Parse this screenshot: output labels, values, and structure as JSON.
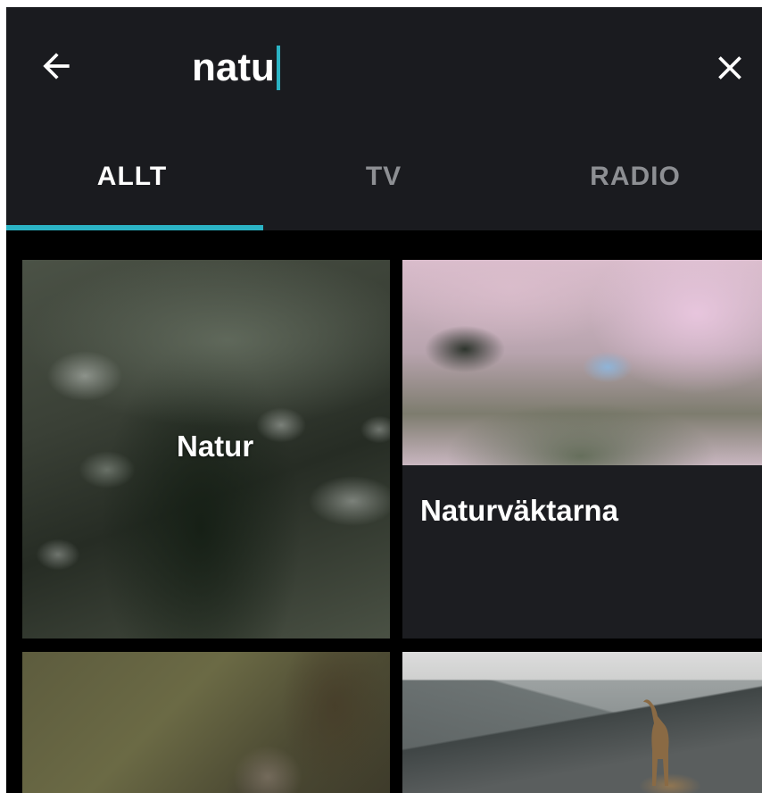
{
  "search": {
    "query": "natu",
    "back_icon": "arrow-left-icon",
    "clear_icon": "close-icon"
  },
  "tabs": [
    {
      "label": "ALLT",
      "active": true
    },
    {
      "label": "TV",
      "active": false
    },
    {
      "label": "RADIO",
      "active": false
    }
  ],
  "results": [
    {
      "title": "Natur"
    },
    {
      "title": "Naturväktarna"
    },
    {
      "title": ""
    },
    {
      "title": ""
    }
  ],
  "colors": {
    "accent": "#2bb3c4",
    "bar_background": "#1a1b1f",
    "background": "#000000",
    "inactive_tab": "#8d8f93"
  }
}
